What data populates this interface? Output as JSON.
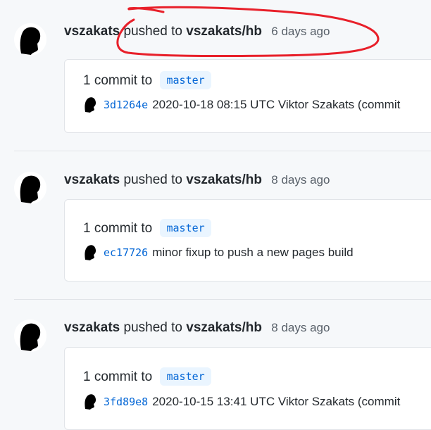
{
  "feed": [
    {
      "user": "vszakats",
      "verb": "pushed to",
      "repo": "vszakats/hb",
      "time": "6 days ago",
      "summary": "1 commit to",
      "branch": "master",
      "sha": "3d1264e",
      "message": "2020-10-18 08:15 UTC Viktor Szakats (commit"
    },
    {
      "user": "vszakats",
      "verb": "pushed to",
      "repo": "vszakats/hb",
      "time": "8 days ago",
      "summary": "1 commit to",
      "branch": "master",
      "sha": "ec17726",
      "message": "minor fixup to push a new pages build"
    },
    {
      "user": "vszakats",
      "verb": "pushed to",
      "repo": "vszakats/hb",
      "time": "8 days ago",
      "summary": "1 commit to",
      "branch": "master",
      "sha": "3fd89e8",
      "message": "2020-10-15 13:41 UTC Viktor Szakats (commit"
    }
  ],
  "colors": {
    "link": "#0366d6",
    "branch_bg": "#eaf5ff",
    "annotation": "#e8202a"
  },
  "icons": {
    "avatar": "user-silhouette-icon"
  }
}
